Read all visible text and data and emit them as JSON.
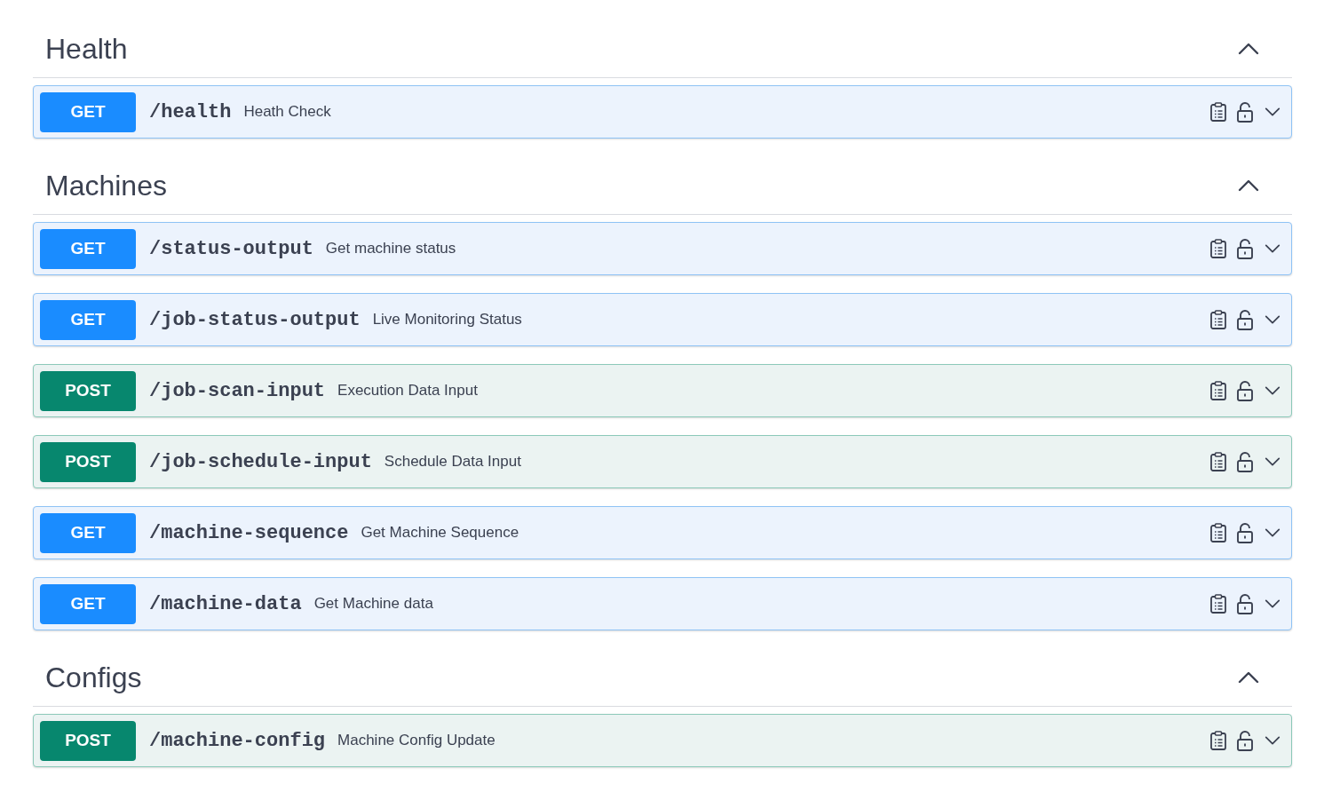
{
  "sections": [
    {
      "title": "Health",
      "expanded": true,
      "operations": [
        {
          "kind": "get",
          "method": "GET",
          "path": "/health",
          "summary": "Heath Check",
          "expanded": false
        }
      ]
    },
    {
      "title": "Machines",
      "expanded": true,
      "operations": [
        {
          "kind": "get",
          "method": "GET",
          "path": "/status-output",
          "summary": "Get machine status",
          "expanded": false
        },
        {
          "kind": "get",
          "method": "GET",
          "path": "/job-status-output",
          "summary": "Live Monitoring Status",
          "expanded": false
        },
        {
          "kind": "post",
          "method": "POST",
          "path": "/job-scan-input",
          "summary": "Execution Data Input",
          "expanded": false
        },
        {
          "kind": "post",
          "method": "POST",
          "path": "/job-schedule-input",
          "summary": "Schedule Data Input",
          "expanded": false
        },
        {
          "kind": "get",
          "method": "GET",
          "path": "/machine-sequence",
          "summary": "Get Machine Sequence",
          "expanded": false
        },
        {
          "kind": "get",
          "method": "GET",
          "path": "/machine-data",
          "summary": "Get Machine data",
          "expanded": false
        }
      ]
    },
    {
      "title": "Configs",
      "expanded": true,
      "operations": [
        {
          "kind": "post",
          "method": "POST",
          "path": "/machine-config",
          "summary": "Machine Config Update",
          "expanded": false
        }
      ]
    }
  ]
}
